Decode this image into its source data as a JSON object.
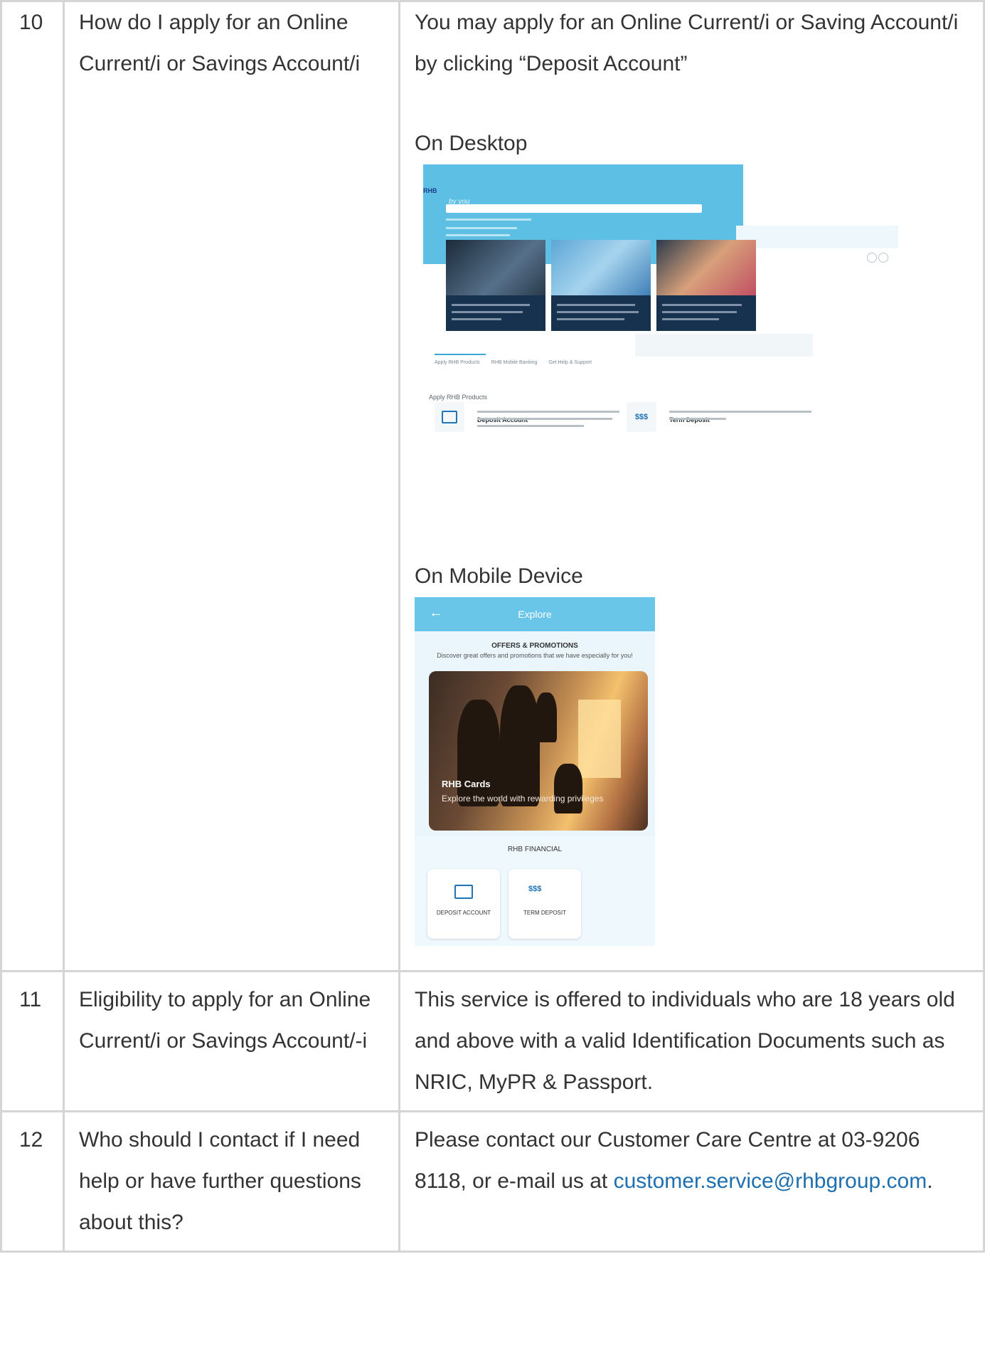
{
  "rows": [
    {
      "number": "10",
      "question": "How do I apply for an Online Current/i or Savings Account/i",
      "answer": "You may apply for an Online Current/i or Saving Account/i by clicking “Deposit Account”",
      "desktop_label": "On Desktop",
      "mobile_label": "On Mobile Device"
    },
    {
      "number": "11",
      "question": "Eligibility to apply for an Online Current/i or Savings Account/-i",
      "answer": "This service is offered to individuals who are 18 years old and above with a valid Identification Documents such as NRIC, MyPR & Passport."
    },
    {
      "number": "12",
      "question": "Who should I contact if I need help or have further questions about this?",
      "answer_prefix": "Please contact our Customer Care Centre at 03-9206 8118, or e-mail us at ",
      "answer_email": "customer.service@rhbgroup.com",
      "answer_suffix": "."
    }
  ],
  "desktop_screenshot": {
    "tab_1": "Apply RHB Products",
    "tab_2": "RHB Mobile Banking",
    "tab_3": "Get Help & Support",
    "section_title": "Apply RHB Products",
    "product_1": "Deposit Account",
    "product_2": "Term Deposit"
  },
  "mobile_screenshot": {
    "header_title": "Explore",
    "offers_title": "OFFERS & PROMOTIONS",
    "offers_desc": "Discover great offers and promotions that we have especially for you!",
    "promo_title": "RHB Cards",
    "promo_desc": "Explore the world with rewarding privileges",
    "financial_label": "RHB FINANCIAL",
    "tile_1": "DEPOSIT ACCOUNT",
    "tile_2": "TERM DEPOSIT"
  },
  "colors": {
    "link": "#1e6fb0",
    "border": "#d5d5d5",
    "brand_blue": "#5ebfe4"
  }
}
